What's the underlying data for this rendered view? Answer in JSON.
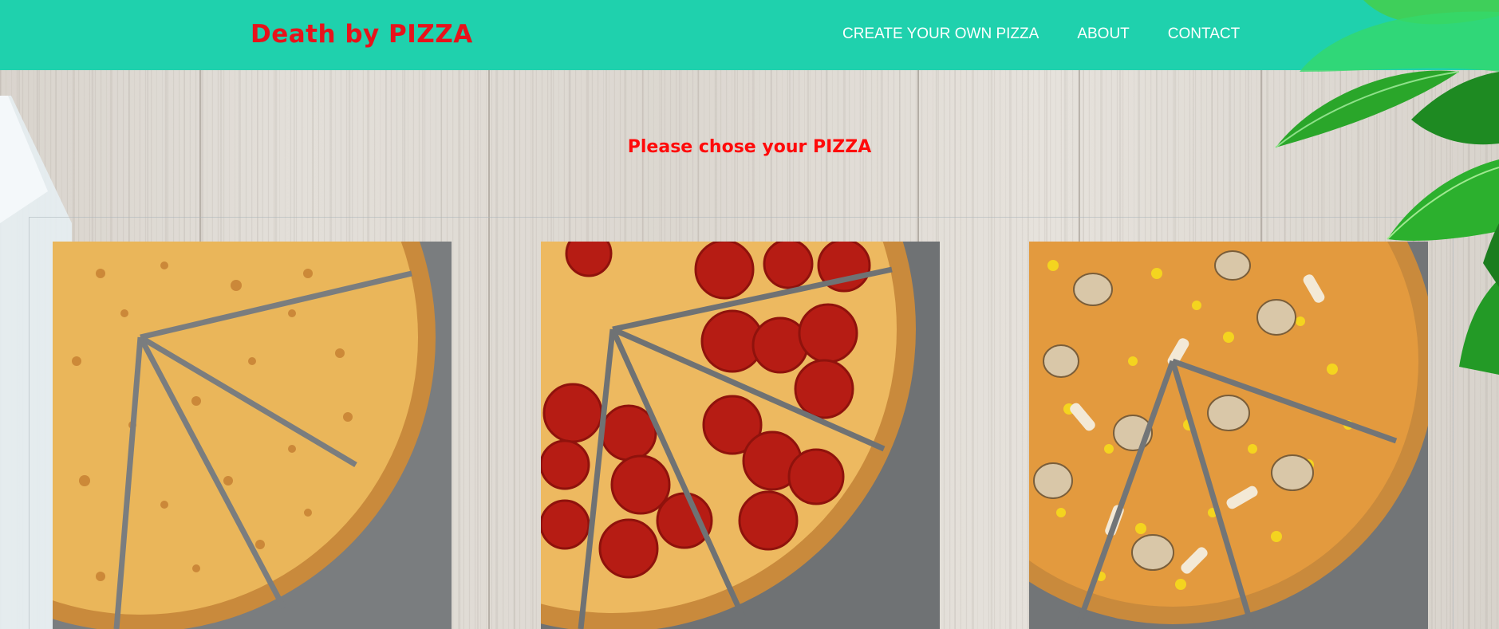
{
  "header": {
    "brand": "Death by PIZZA",
    "nav": [
      {
        "label": "CREATE YOUR OWN PIZZA"
      },
      {
        "label": "ABOUT"
      },
      {
        "label": "CONTACT"
      }
    ]
  },
  "main": {
    "prompt": "Please chose your PIZZA",
    "pizzas": [
      {
        "kind": "cheese-pizza"
      },
      {
        "kind": "pepperoni-pizza"
      },
      {
        "kind": "mushroom-corn-pizza"
      }
    ]
  },
  "colors": {
    "header_bg": "#1fd1ad",
    "brand_text": "#e8121b",
    "prompt_text": "#ff0a0a",
    "nav_text": "#ffffff"
  }
}
